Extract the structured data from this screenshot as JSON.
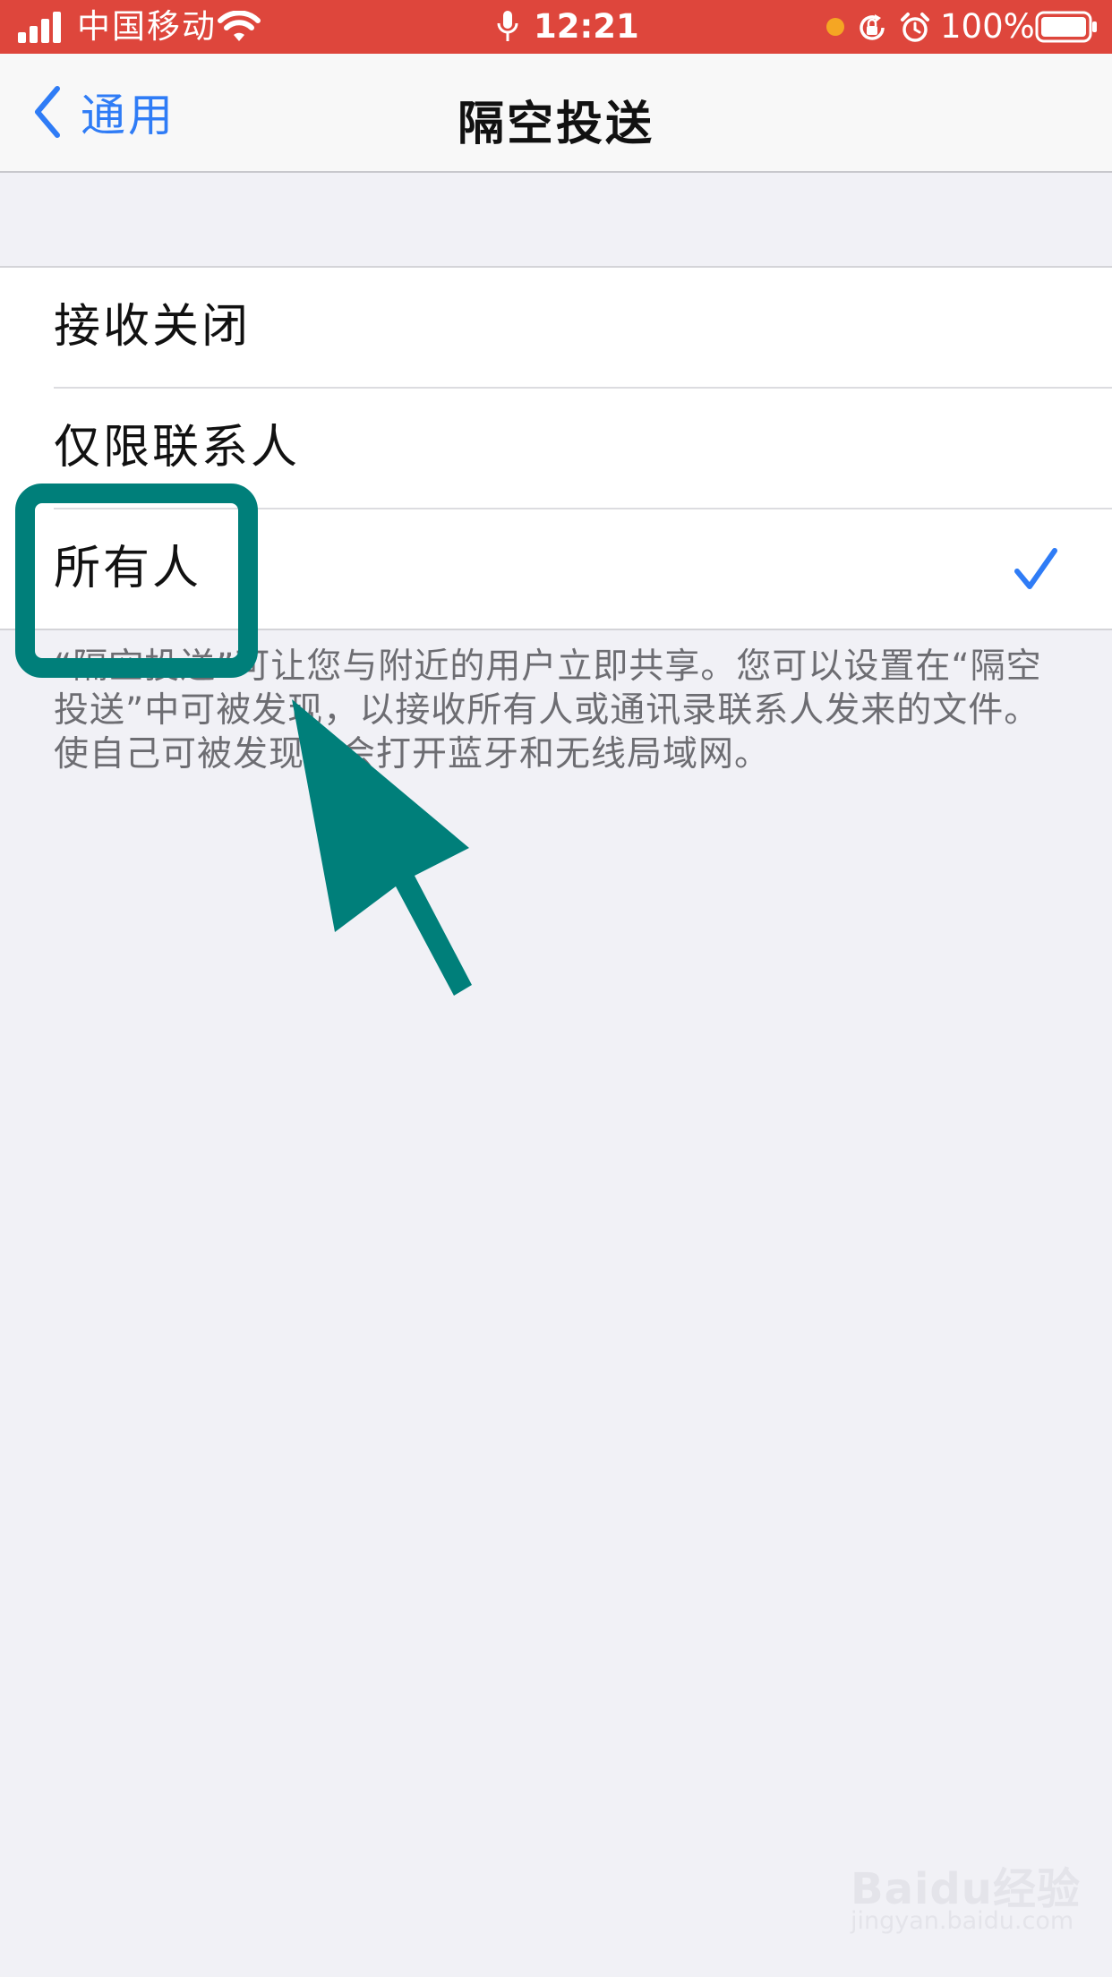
{
  "status_bar": {
    "carrier": "中国移动",
    "time": "12:21",
    "battery": "100%",
    "icons": [
      "signal-bars-icon",
      "wifi-icon",
      "microphone-icon",
      "orange-dot-icon",
      "rotation-lock-icon",
      "alarm-icon",
      "battery-icon"
    ],
    "background_color": "#de463c"
  },
  "nav": {
    "back_label": "通用",
    "title": "隔空投送",
    "accent_color": "#2f7cf6"
  },
  "options": [
    {
      "label": "接收关闭",
      "selected": false
    },
    {
      "label": "仅限联系人",
      "selected": false
    },
    {
      "label": "所有人",
      "selected": true
    }
  ],
  "footer_note": "“隔空投送”可让您与附近的用户立即共享。您可以设置在“隔空投送”中可被发现，以接收所有人或通讯录联系人发来的文件。使自己可被发现将会打开蓝牙和无线局域网。",
  "annotation": {
    "color": "#007f7a",
    "highlight_target": "所有人"
  },
  "watermark": {
    "brand": "Baidu经验",
    "site": "jingyan.baidu.com"
  }
}
